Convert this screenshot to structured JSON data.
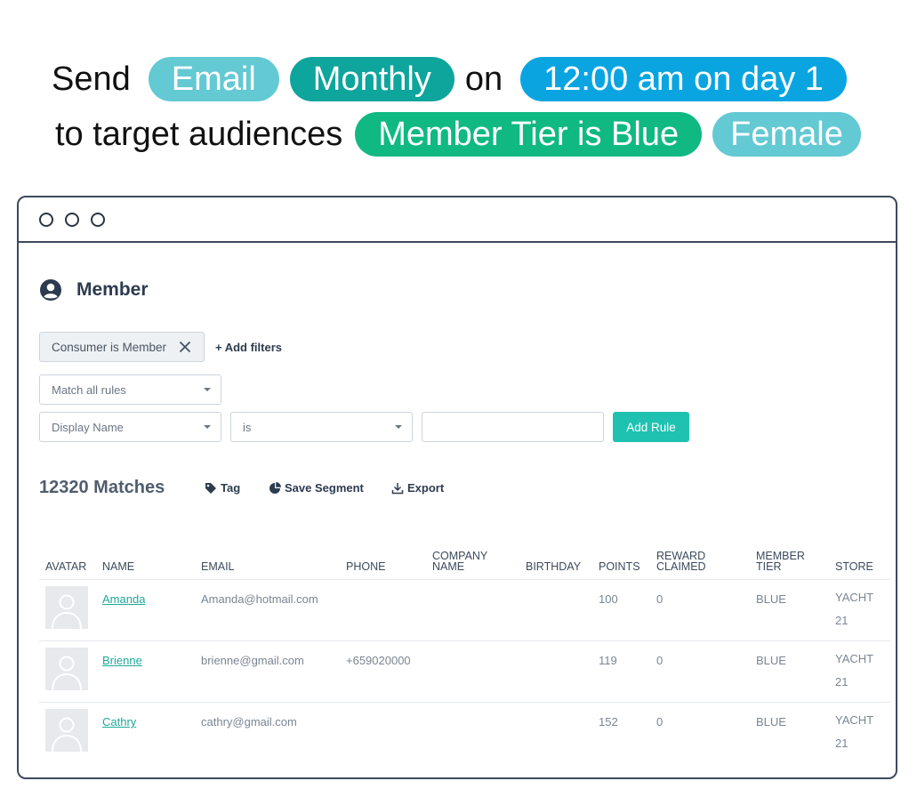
{
  "colors": {
    "pill_teal_light": "#63c9d3",
    "pill_teal_dark": "#0ea59c",
    "pill_blue": "#0aa5e1",
    "pill_green": "#10b981",
    "accent": "#1fc2b0"
  },
  "sentence": {
    "line1_word1": "Send",
    "channel": "Email",
    "frequency": "Monthly",
    "line1_word2": "on",
    "schedule": "12:00 am on day 1",
    "line2_word1": "to target audiences",
    "audience_1": "Member Tier is Blue",
    "audience_2": "Female"
  },
  "page": {
    "title": "Member",
    "icon": "user-circle-icon"
  },
  "filters": {
    "chip_label": "Consumer is Member",
    "add_filters_label": "+ Add filters",
    "match_select": "Match all rules",
    "field_select": "Display Name",
    "operator_select": "is",
    "value_input": "",
    "add_rule_label": "Add Rule"
  },
  "results": {
    "matches_label": "12320 Matches",
    "tag_label": "Tag",
    "save_segment_label": "Save Segment",
    "export_label": "Export"
  },
  "table": {
    "headers": {
      "avatar": "AVATAR",
      "name": "NAME",
      "email": "EMAIL",
      "phone": "PHONE",
      "company_1": "COMPANY",
      "company_2": "NAME",
      "birthday": "BIRTHDAY",
      "points": "POINTS",
      "reward_1": "REWARD",
      "reward_2": "CLAIMED",
      "tier_1": "MEMBER",
      "tier_2": "TIER",
      "store": "STORE"
    },
    "rows": [
      {
        "name": "Amanda",
        "email": "Amanda@hotmail.com",
        "phone": "",
        "company": "",
        "birthday": "",
        "points": "100",
        "reward": "0",
        "tier": "BLUE",
        "store_1": "YACHT",
        "store_2": "21"
      },
      {
        "name": "Brienne",
        "email": "brienne@gmail.com",
        "phone": "+659020000",
        "company": "",
        "birthday": "",
        "points": "119",
        "reward": "0",
        "tier": "BLUE",
        "store_1": "YACHT",
        "store_2": "21"
      },
      {
        "name": "Cathry",
        "email": "cathry@gmail.com",
        "phone": "",
        "company": "",
        "birthday": "",
        "points": "152",
        "reward": "0",
        "tier": "BLUE",
        "store_1": "YACHT",
        "store_2": "21"
      }
    ]
  }
}
